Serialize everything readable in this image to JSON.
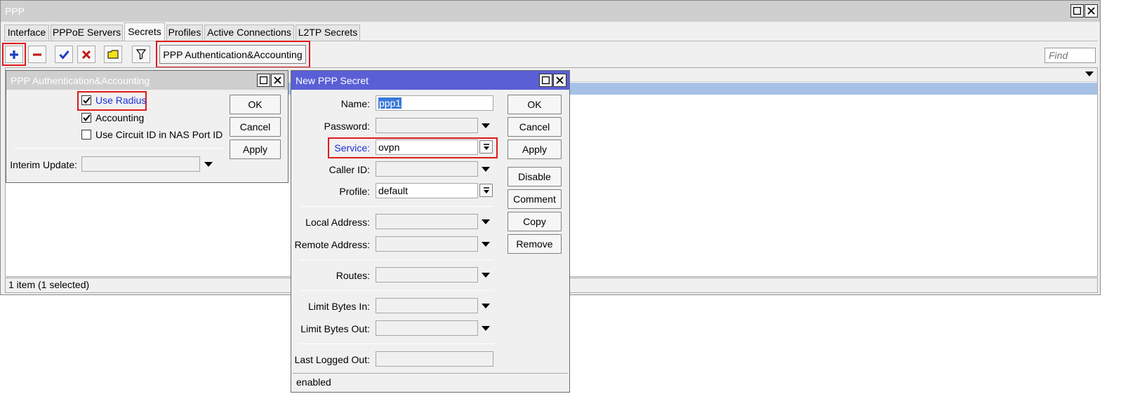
{
  "window": {
    "title": "PPP",
    "tabs": [
      "Interface",
      "PPPoE Servers",
      "Secrets",
      "Profiles",
      "Active Connections",
      "L2TP Secrets"
    ],
    "active_tab": "Secrets"
  },
  "toolbar": {
    "auth_button_label": "PPP Authentication&Accounting",
    "find_placeholder": "Find"
  },
  "statusbar": {
    "text": "1 item (1 selected)"
  },
  "auth_dialog": {
    "title": "PPP Authentication&Accounting",
    "use_radius_label": "Use Radius",
    "use_radius_checked": true,
    "accounting_label": "Accounting",
    "accounting_checked": true,
    "circuit_id_label": "Use Circuit ID in NAS Port ID",
    "circuit_id_checked": false,
    "interim_update_label": "Interim Update:",
    "interim_update_value": "",
    "ok_label": "OK",
    "cancel_label": "Cancel",
    "apply_label": "Apply"
  },
  "secret_dialog": {
    "title": "New PPP Secret",
    "fields": {
      "name": {
        "label": "Name:",
        "value": "ppp1"
      },
      "password": {
        "label": "Password:",
        "value": ""
      },
      "service": {
        "label": "Service:",
        "value": "ovpn"
      },
      "caller_id": {
        "label": "Caller ID:",
        "value": ""
      },
      "profile": {
        "label": "Profile:",
        "value": "default"
      },
      "local_address": {
        "label": "Local Address:",
        "value": ""
      },
      "remote_address": {
        "label": "Remote Address:",
        "value": ""
      },
      "routes": {
        "label": "Routes:",
        "value": ""
      },
      "limit_bytes_in": {
        "label": "Limit Bytes In:",
        "value": ""
      },
      "limit_bytes_out": {
        "label": "Limit Bytes Out:",
        "value": ""
      },
      "last_logged_out": {
        "label": "Last Logged Out:",
        "value": ""
      }
    },
    "buttons": {
      "ok": "OK",
      "cancel": "Cancel",
      "apply": "Apply",
      "disable": "Disable",
      "comment": "Comment",
      "copy": "Copy",
      "remove": "Remove"
    },
    "status": "enabled"
  },
  "colors": {
    "highlight_red": "#e01a1a",
    "active_title_blue": "#5a5fd6",
    "selection_blue": "#a6c1e6",
    "link_blue": "#1a2fd6"
  }
}
